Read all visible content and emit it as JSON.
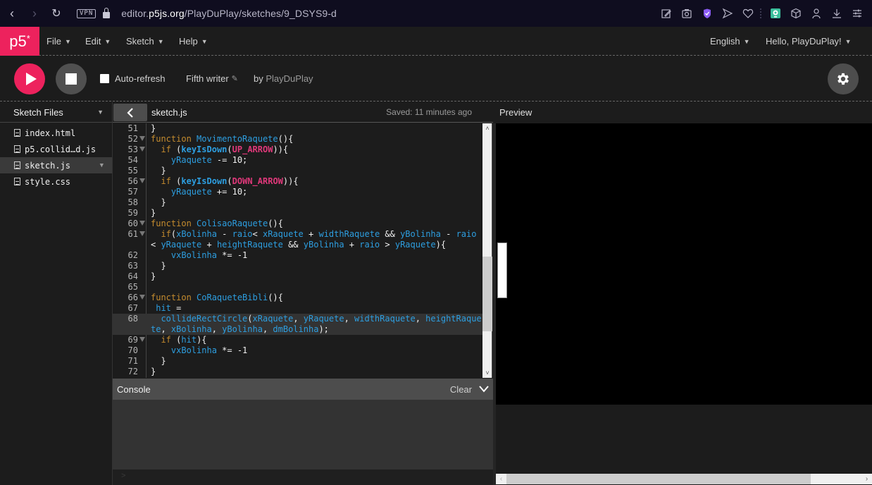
{
  "browser": {
    "url_prefix": "editor.",
    "url_domain": "p5js.org",
    "url_path": "/PlayDuPlay/sketches/9_DSYS9-d",
    "vpn_label": "VPN",
    "icons": [
      "edit-page-icon",
      "camera-icon",
      "shield-check-icon",
      "send-icon",
      "heart-icon",
      "extension-icon",
      "cube-icon",
      "profile-icon",
      "download-icon",
      "settings-sliders-icon"
    ],
    "accent_shield": "#8b5cf6",
    "accent_extension": "#3bbf9c"
  },
  "nav": {
    "logo": "p5",
    "logo_sup": "*",
    "menus": [
      {
        "label": "File"
      },
      {
        "label": "Edit"
      },
      {
        "label": "Sketch"
      },
      {
        "label": "Help"
      }
    ],
    "language": "English",
    "user_greeting": "Hello, PlayDuPlay!"
  },
  "toolbar": {
    "auto_refresh_label": "Auto-refresh",
    "auto_refresh_checked": false,
    "sketch_name": "Fifth writer",
    "by_label": "by",
    "owner": "PlayDuPlay",
    "play_color": "#ed225d"
  },
  "sidebar": {
    "title": "Sketch Files",
    "files": [
      {
        "name": "index.html",
        "active": false
      },
      {
        "name": "p5.collid…d.js",
        "active": false
      },
      {
        "name": "sketch.js",
        "active": true
      },
      {
        "name": "style.css",
        "active": false
      }
    ]
  },
  "editor": {
    "filename": "sketch.js",
    "saved_status": "Saved: 11 minutes ago",
    "lines": [
      {
        "n": "51",
        "fold": false,
        "hl": false,
        "tokens": [
          [
            "o",
            "}"
          ]
        ]
      },
      {
        "n": "52",
        "fold": true,
        "hl": false,
        "tokens": [
          [
            "k",
            "function "
          ],
          [
            "f",
            "MovimentoRaquete"
          ],
          [
            "o",
            "(){"
          ]
        ]
      },
      {
        "n": "53",
        "fold": true,
        "hl": false,
        "tokens": [
          [
            "o",
            "  "
          ],
          [
            "k",
            "if "
          ],
          [
            "o",
            "("
          ],
          [
            "b",
            "keyIsDown"
          ],
          [
            "o",
            "("
          ],
          [
            "c",
            "UP_ARROW"
          ],
          [
            "o",
            "))"
          ],
          [
            "o",
            "{"
          ]
        ]
      },
      {
        "n": "54",
        "fold": false,
        "hl": false,
        "tokens": [
          [
            "o",
            "    "
          ],
          [
            "v",
            "yRaquete"
          ],
          [
            "o",
            " -= 10;"
          ]
        ]
      },
      {
        "n": "55",
        "fold": false,
        "hl": false,
        "tokens": [
          [
            "o",
            "  }"
          ]
        ]
      },
      {
        "n": "56",
        "fold": true,
        "hl": false,
        "tokens": [
          [
            "o",
            "  "
          ],
          [
            "k",
            "if "
          ],
          [
            "o",
            "("
          ],
          [
            "b",
            "keyIsDown"
          ],
          [
            "o",
            "("
          ],
          [
            "c",
            "DOWN_ARROW"
          ],
          [
            "o",
            "))"
          ],
          [
            "o",
            "{"
          ]
        ]
      },
      {
        "n": "57",
        "fold": false,
        "hl": false,
        "tokens": [
          [
            "o",
            "    "
          ],
          [
            "v",
            "yRaquete"
          ],
          [
            "o",
            " += 10;"
          ]
        ]
      },
      {
        "n": "58",
        "fold": false,
        "hl": false,
        "tokens": [
          [
            "o",
            "  }"
          ]
        ]
      },
      {
        "n": "59",
        "fold": false,
        "hl": false,
        "tokens": [
          [
            "o",
            "}"
          ]
        ]
      },
      {
        "n": "60",
        "fold": true,
        "hl": false,
        "tokens": [
          [
            "k",
            "function "
          ],
          [
            "f",
            "ColisaoRaquete"
          ],
          [
            "o",
            "(){"
          ]
        ]
      },
      {
        "n": "61",
        "fold": true,
        "hl": false,
        "tokens": [
          [
            "o",
            "  "
          ],
          [
            "k",
            "if"
          ],
          [
            "o",
            "("
          ],
          [
            "v",
            "xBolinha"
          ],
          [
            "o",
            " - "
          ],
          [
            "v",
            "raio"
          ],
          [
            "o",
            "< "
          ],
          [
            "v",
            "xRaquete"
          ],
          [
            "o",
            " + "
          ],
          [
            "v",
            "widthRaquete"
          ],
          [
            "o",
            " && "
          ],
          [
            "v",
            "yBolinha"
          ],
          [
            "o",
            " - "
          ],
          [
            "v",
            "raio"
          ],
          [
            "o",
            " < "
          ],
          [
            "v",
            "yRaquete"
          ],
          [
            "o",
            " + "
          ],
          [
            "v",
            "heightRaquete"
          ],
          [
            "o",
            " && "
          ],
          [
            "v",
            "yBolinha"
          ],
          [
            "o",
            " + "
          ],
          [
            "v",
            "raio"
          ],
          [
            "o",
            " > "
          ],
          [
            "v",
            "yRaquete"
          ],
          [
            "o",
            "){"
          ]
        ]
      },
      {
        "n": "62",
        "fold": false,
        "hl": false,
        "tokens": [
          [
            "o",
            "    "
          ],
          [
            "v",
            "vxBolinha"
          ],
          [
            "o",
            " *= -1"
          ]
        ]
      },
      {
        "n": "63",
        "fold": false,
        "hl": false,
        "tokens": [
          [
            "o",
            "  }"
          ]
        ]
      },
      {
        "n": "64",
        "fold": false,
        "hl": false,
        "tokens": [
          [
            "o",
            "}"
          ]
        ]
      },
      {
        "n": "65",
        "fold": false,
        "hl": false,
        "tokens": [
          [
            "o",
            " "
          ]
        ]
      },
      {
        "n": "66",
        "fold": true,
        "hl": false,
        "tokens": [
          [
            "k",
            "function "
          ],
          [
            "f",
            "CoRaqueteBibli"
          ],
          [
            "o",
            "(){"
          ]
        ]
      },
      {
        "n": "67",
        "fold": false,
        "hl": false,
        "tokens": [
          [
            "o",
            " "
          ],
          [
            "v",
            "hit"
          ],
          [
            "o",
            " ="
          ]
        ]
      },
      {
        "n": "68",
        "fold": false,
        "hl": true,
        "tokens": [
          [
            "o",
            "  "
          ],
          [
            "v",
            "collideRectCircle"
          ],
          [
            "o",
            "("
          ],
          [
            "v",
            "xRaquete"
          ],
          [
            "o",
            ", "
          ],
          [
            "v",
            "yRaquete"
          ],
          [
            "o",
            ", "
          ],
          [
            "v",
            "widthRaquete"
          ],
          [
            "o",
            ", "
          ],
          [
            "v",
            "heightRaquete"
          ],
          [
            "o",
            ", "
          ],
          [
            "v",
            "xBolinha"
          ],
          [
            "o",
            ", "
          ],
          [
            "v",
            "yBolinha"
          ],
          [
            "o",
            ", "
          ],
          [
            "v",
            "dmBolinha"
          ],
          [
            "o",
            ");"
          ]
        ]
      },
      {
        "n": "69",
        "fold": true,
        "hl": false,
        "tokens": [
          [
            "o",
            "  "
          ],
          [
            "k",
            "if "
          ],
          [
            "o",
            "("
          ],
          [
            "v",
            "hit"
          ],
          [
            "o",
            "){"
          ]
        ]
      },
      {
        "n": "70",
        "fold": false,
        "hl": false,
        "tokens": [
          [
            "o",
            "    "
          ],
          [
            "v",
            "vxBolinha"
          ],
          [
            "o",
            " *= -1"
          ]
        ]
      },
      {
        "n": "71",
        "fold": false,
        "hl": false,
        "tokens": [
          [
            "o",
            "  }"
          ]
        ]
      },
      {
        "n": "72",
        "fold": false,
        "hl": false,
        "tokens": [
          [
            "o",
            "}"
          ]
        ]
      }
    ]
  },
  "console": {
    "title": "Console",
    "clear_label": "Clear",
    "prompt": ">"
  },
  "preview": {
    "title": "Preview",
    "canvas_bg": "#000000",
    "paddle_color": "#ffffff"
  }
}
